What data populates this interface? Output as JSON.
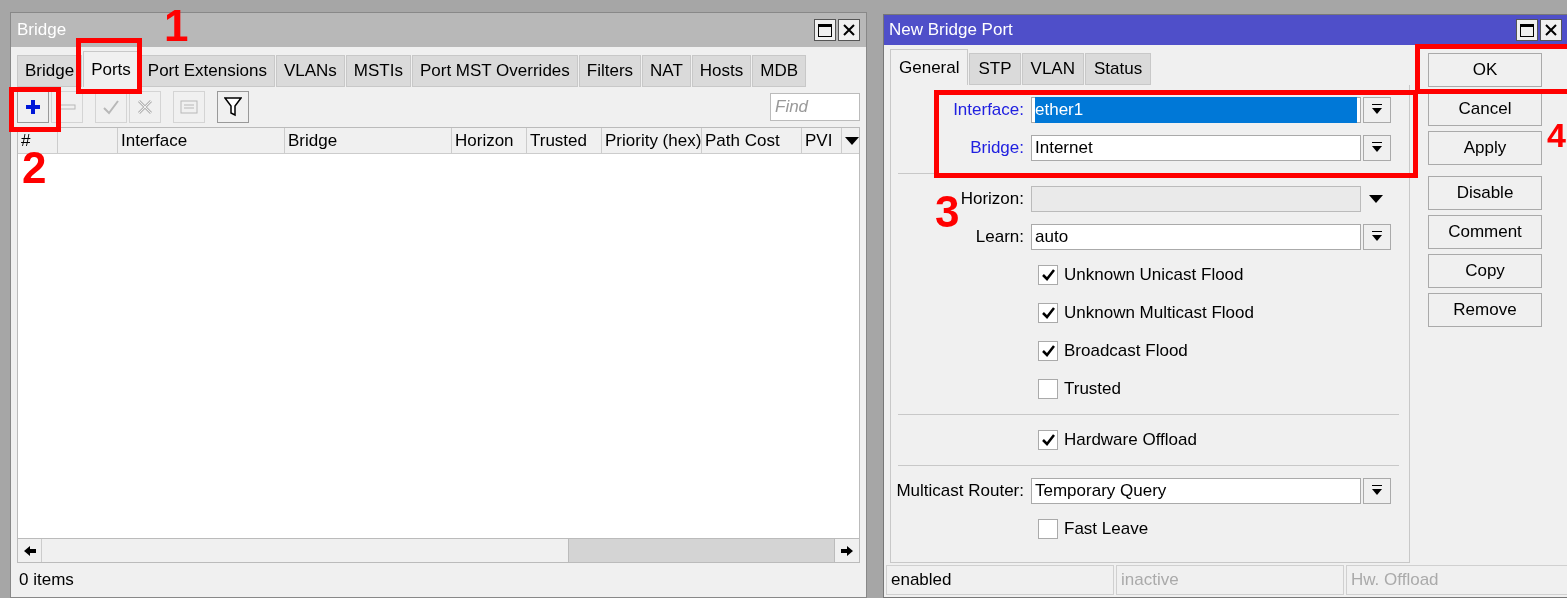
{
  "bridge_window": {
    "title": "Bridge",
    "tabs": [
      {
        "label": "Bridge",
        "selected": false
      },
      {
        "label": "Ports",
        "selected": true
      },
      {
        "label": "Port Extensions",
        "selected": false
      },
      {
        "label": "VLANs",
        "selected": false
      },
      {
        "label": "MSTIs",
        "selected": false
      },
      {
        "label": "Port MST Overrides",
        "selected": false
      },
      {
        "label": "Filters",
        "selected": false
      },
      {
        "label": "NAT",
        "selected": false
      },
      {
        "label": "Hosts",
        "selected": false
      },
      {
        "label": "MDB",
        "selected": false
      }
    ],
    "toolbar": [
      {
        "kind": "add",
        "disabled": false
      },
      {
        "kind": "remove",
        "disabled": true
      },
      {
        "kind": "enable",
        "disabled": true
      },
      {
        "kind": "disable",
        "disabled": true
      },
      {
        "kind": "comment",
        "disabled": true
      },
      {
        "kind": "filter",
        "disabled": false
      }
    ],
    "search": {
      "placeholder": "Find"
    },
    "table": {
      "columns": [
        "#",
        "",
        "Interface",
        "Bridge",
        "Horizon",
        "Trusted",
        "Priority (hex)",
        "Path Cost",
        "PVI"
      ]
    },
    "status_bar": "0 items"
  },
  "port_dialog": {
    "title": "New Bridge Port",
    "tabs": [
      {
        "label": "General",
        "selected": true
      },
      {
        "label": "STP",
        "selected": false
      },
      {
        "label": "VLAN",
        "selected": false
      },
      {
        "label": "Status",
        "selected": false
      }
    ],
    "fields": [
      {
        "kind": "select",
        "label": "Interface:",
        "value": "ether1",
        "highlight": true,
        "focused": true
      },
      {
        "kind": "select",
        "label": "Bridge:",
        "value": "Internet",
        "highlight": true,
        "focused": false
      },
      {
        "kind": "separator"
      },
      {
        "kind": "combo",
        "label": "Horizon:"
      },
      {
        "kind": "select",
        "label": "Learn:",
        "value": "auto",
        "highlight": false,
        "focused": false
      },
      {
        "kind": "checkbox",
        "label": "Unknown Unicast Flood",
        "checked": true
      },
      {
        "kind": "checkbox",
        "label": "Unknown Multicast Flood",
        "checked": true
      },
      {
        "kind": "checkbox",
        "label": "Broadcast Flood",
        "checked": true
      },
      {
        "kind": "checkbox",
        "label": "Trusted",
        "checked": false
      },
      {
        "kind": "separator"
      },
      {
        "kind": "checkbox",
        "label": "Hardware Offload",
        "checked": true
      },
      {
        "kind": "separator"
      },
      {
        "kind": "select",
        "label": "Multicast Router:",
        "value": "Temporary Query",
        "highlight": false,
        "focused": false
      },
      {
        "kind": "checkbox",
        "label": "Fast Leave",
        "checked": false
      }
    ],
    "buttons": [
      "OK",
      "Cancel",
      "Apply",
      "Disable",
      "Comment",
      "Copy",
      "Remove"
    ],
    "status_bar": [
      {
        "text": "enabled",
        "dimmed": false
      },
      {
        "text": "inactive",
        "dimmed": true
      },
      {
        "text": "Hw. Offload",
        "dimmed": true
      }
    ]
  },
  "annotations": [
    "1",
    "2",
    "3",
    "4"
  ]
}
